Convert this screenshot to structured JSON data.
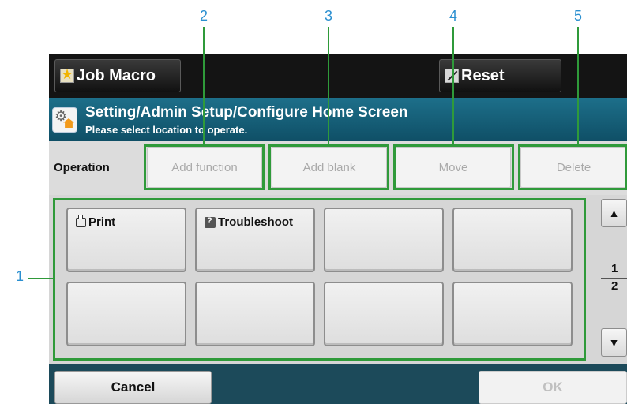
{
  "callouts": [
    "1",
    "2",
    "3",
    "4",
    "5"
  ],
  "topbar": {
    "job_macro_label": "Job Macro",
    "job_macro_icon": "star-icon",
    "reset_label": "Reset",
    "reset_icon": "reset-icon"
  },
  "titlebar": {
    "icon": "settings-home-icon",
    "title": "Setting/Admin Setup/Configure Home Screen",
    "subtitle": "Please select location to operate."
  },
  "operation": {
    "label": "Operation",
    "buttons": [
      "Add function",
      "Add blank",
      "Move",
      "Delete"
    ]
  },
  "grid": {
    "cells": [
      {
        "label": "Print",
        "icon": "print-icon"
      },
      {
        "label": "Troubleshoot",
        "icon": "troubleshoot-icon"
      },
      {
        "label": "",
        "icon": ""
      },
      {
        "label": "",
        "icon": ""
      },
      {
        "label": "",
        "icon": ""
      },
      {
        "label": "",
        "icon": ""
      },
      {
        "label": "",
        "icon": ""
      },
      {
        "label": "",
        "icon": ""
      }
    ]
  },
  "pager": {
    "up": "▲",
    "down": "▼",
    "current": "1",
    "total": "2"
  },
  "footer": {
    "cancel_label": "Cancel",
    "ok_label": "OK"
  },
  "colors": {
    "topbar": "#141414",
    "titlebar": "#1d6f8a",
    "highlight": "#2f9a3a",
    "callout": "#2a8fd0",
    "footer": "#1c4a5a"
  }
}
